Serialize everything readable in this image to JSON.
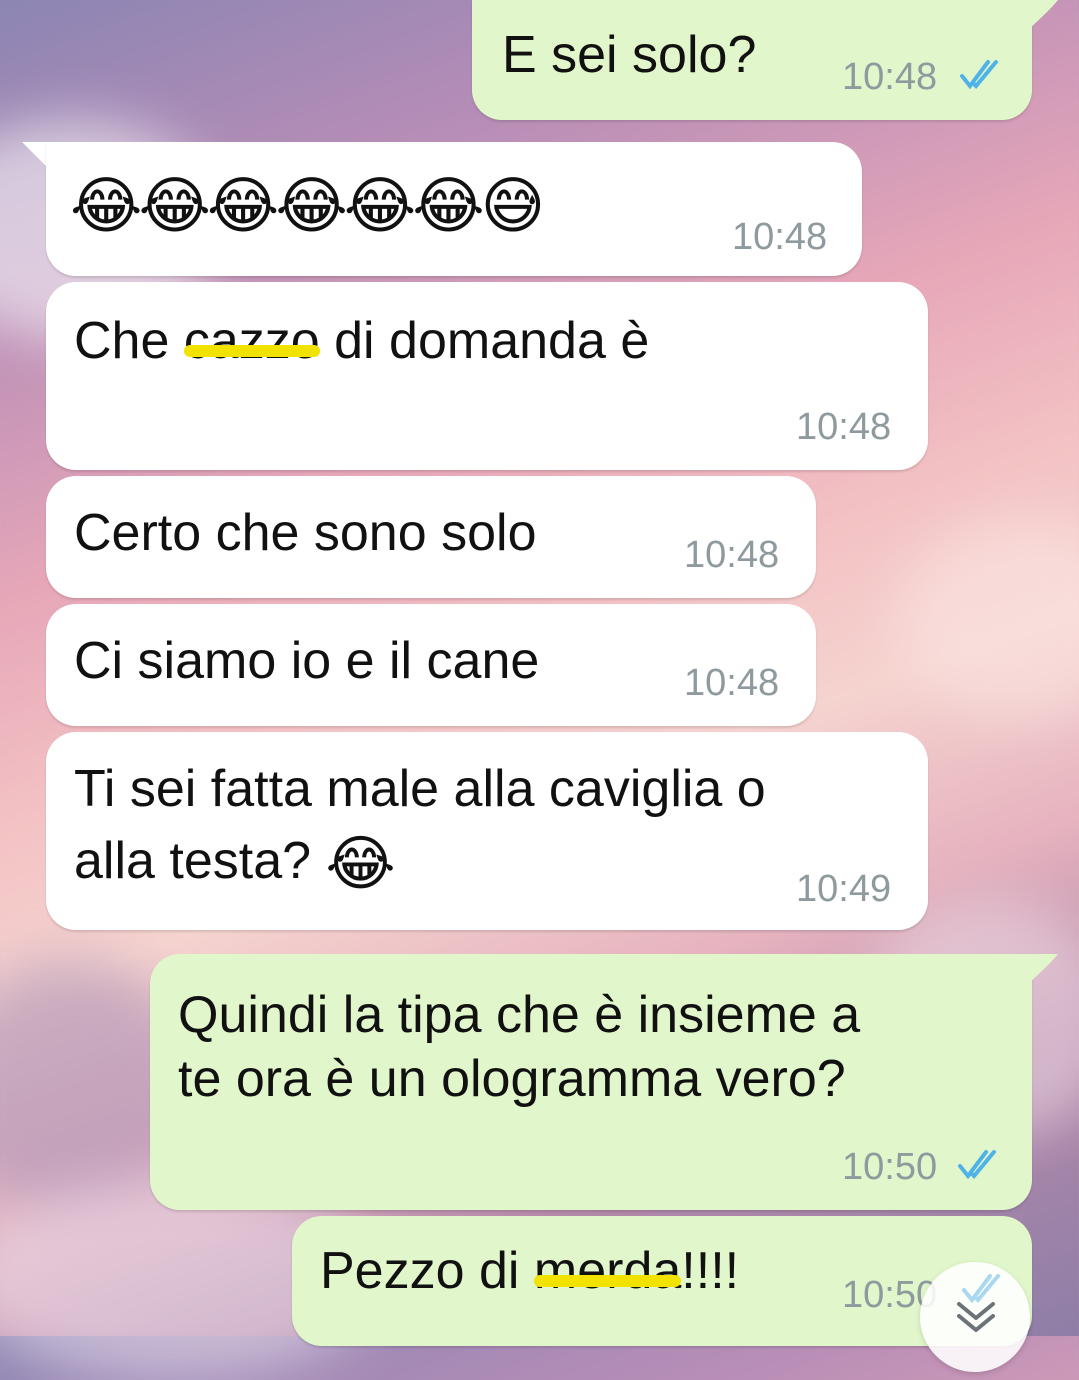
{
  "messages": [
    {
      "side": "out",
      "text": "E sei solo?",
      "time": "10:48",
      "read": true
    },
    {
      "side": "in",
      "text": "😂😂😂😂😂😂😅",
      "time": "10:48"
    },
    {
      "side": "in",
      "pre": "Che ",
      "censored": "cazzo",
      "post": " di domanda è",
      "time": "10:48"
    },
    {
      "side": "in",
      "text": "Certo che sono solo",
      "time": "10:48"
    },
    {
      "side": "in",
      "text": "Ci siamo io e il cane",
      "time": "10:48"
    },
    {
      "side": "in",
      "line1": "Ti sei fatta male alla caviglia o",
      "line2": "alla testa?",
      "emoji": "😂",
      "time": "10:49"
    },
    {
      "side": "out",
      "line1": "Quindi la tipa che è insieme a",
      "line2": "te ora è un ologramma vero?",
      "time": "10:50",
      "read": true
    },
    {
      "side": "out",
      "pre": "Pezzo di ",
      "censored": "merda",
      "post": "!!!!",
      "time": "10:50",
      "read": true
    }
  ],
  "colors": {
    "incoming": "#ffffff",
    "outgoing": "#e1f7cb",
    "read_ticks": "#4fb3e8",
    "time": "#8f9a9e",
    "censor": "#f1e200"
  },
  "icons": {
    "read": "double-check-icon",
    "scroll": "chevron-double-down-icon",
    "emoji": "emoji-icon"
  }
}
